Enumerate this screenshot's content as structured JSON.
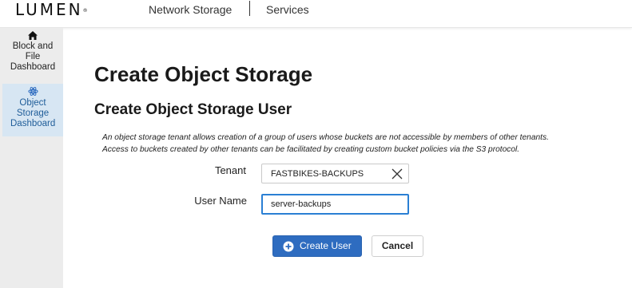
{
  "header": {
    "logo_text": "LUMEN",
    "logo_mark": "®",
    "nav": [
      {
        "label": "Network Storage"
      },
      {
        "label": "Services"
      }
    ]
  },
  "sidebar": {
    "items": [
      {
        "icon": "home-icon",
        "label": "Block and File Dashboard",
        "active": false
      },
      {
        "icon": "atom-icon",
        "label": "Object Storage Dashboard",
        "active": true
      }
    ]
  },
  "main": {
    "page_title": "Create Object Storage",
    "section_title": "Create Object Storage User",
    "description_line1": "An object storage tenant allows creation of a group of users whose buckets are not accessible by members of other tenants.",
    "description_line2": "Access to buckets created by other tenants can be facilitated by creating custom bucket policies via the S3 protocol.",
    "form": {
      "tenant_label": "Tenant",
      "tenant_value": "FASTBIKES-BACKUPS",
      "username_label": "User Name",
      "username_value": "server-backups"
    },
    "buttons": {
      "create_label": "Create User",
      "cancel_label": "Cancel"
    }
  },
  "colors": {
    "primary": "#2e6cc0",
    "active_sidebar_bg": "#d7e6f3",
    "active_sidebar_text": "#1f5d99",
    "focus_border": "#2a7fd4"
  }
}
